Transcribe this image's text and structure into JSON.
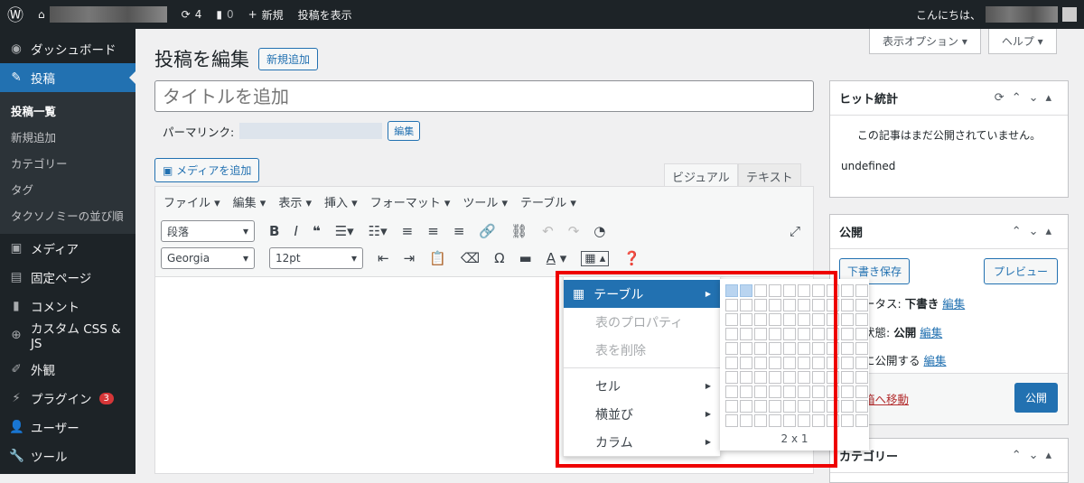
{
  "adminbar": {
    "updates": "4",
    "comments": "0",
    "new": "新規",
    "view_post": "投稿を表示",
    "greeting": "こんにちは、"
  },
  "sidebar": {
    "items": [
      {
        "label": "ダッシュボード"
      },
      {
        "label": "投稿"
      },
      {
        "label": "メディア"
      },
      {
        "label": "固定ページ"
      },
      {
        "label": "コメント"
      },
      {
        "label": "カスタム CSS & JS"
      },
      {
        "label": "外観"
      },
      {
        "label": "プラグイン",
        "badge": "3"
      },
      {
        "label": "ユーザー"
      },
      {
        "label": "ツール"
      }
    ],
    "sub": [
      "投稿一覧",
      "新規追加",
      "カテゴリー",
      "タグ",
      "タクソノミーの並び順"
    ]
  },
  "header": {
    "title": "投稿を編集",
    "add_new": "新規追加",
    "screen_options": "表示オプション ▾",
    "help": "ヘルプ ▾"
  },
  "editor": {
    "title_placeholder": "タイトルを追加",
    "permalink_label": "パーマリンク:",
    "permalink_edit": "編集",
    "add_media": "メディアを追加",
    "tab_visual": "ビジュアル",
    "tab_text": "テキスト",
    "menus": [
      "ファイル ▾",
      "編集 ▾",
      "表示 ▾",
      "挿入 ▾",
      "フォーマット ▾",
      "ツール ▾",
      "テーブル ▾"
    ],
    "format": "段落",
    "font": "Georgia",
    "size": "12pt"
  },
  "table_menu": {
    "items": [
      {
        "label": "テーブル",
        "state": "highlighted"
      },
      {
        "label": "表のプロパティ",
        "state": "disabled"
      },
      {
        "label": "表を削除",
        "state": "disabled"
      },
      {
        "label": "セル"
      },
      {
        "label": "横並び"
      },
      {
        "label": "カラム"
      }
    ],
    "grid_size": "2 x 1",
    "grid_cols": 10,
    "grid_rows": 10,
    "selected_cols": 2,
    "selected_rows": 1
  },
  "hit_stats": {
    "title": "ヒット統計",
    "message": "この記事はまだ公開されていません。",
    "footer": "undefined"
  },
  "publish": {
    "title": "公開",
    "save_draft": "下書き保存",
    "preview": "プレビュー",
    "status": "ステータス: ",
    "status_val": "下書き",
    "visibility": "公開状態: ",
    "visibility_val": "公開",
    "schedule": "すぐに公開する",
    "edit": "編集",
    "trash": "ゴミ箱へ移動",
    "publish": "公開"
  },
  "category": {
    "title": "カテゴリー"
  },
  "colors": {
    "accent": "#2271b1",
    "highlight": "#e00000"
  }
}
